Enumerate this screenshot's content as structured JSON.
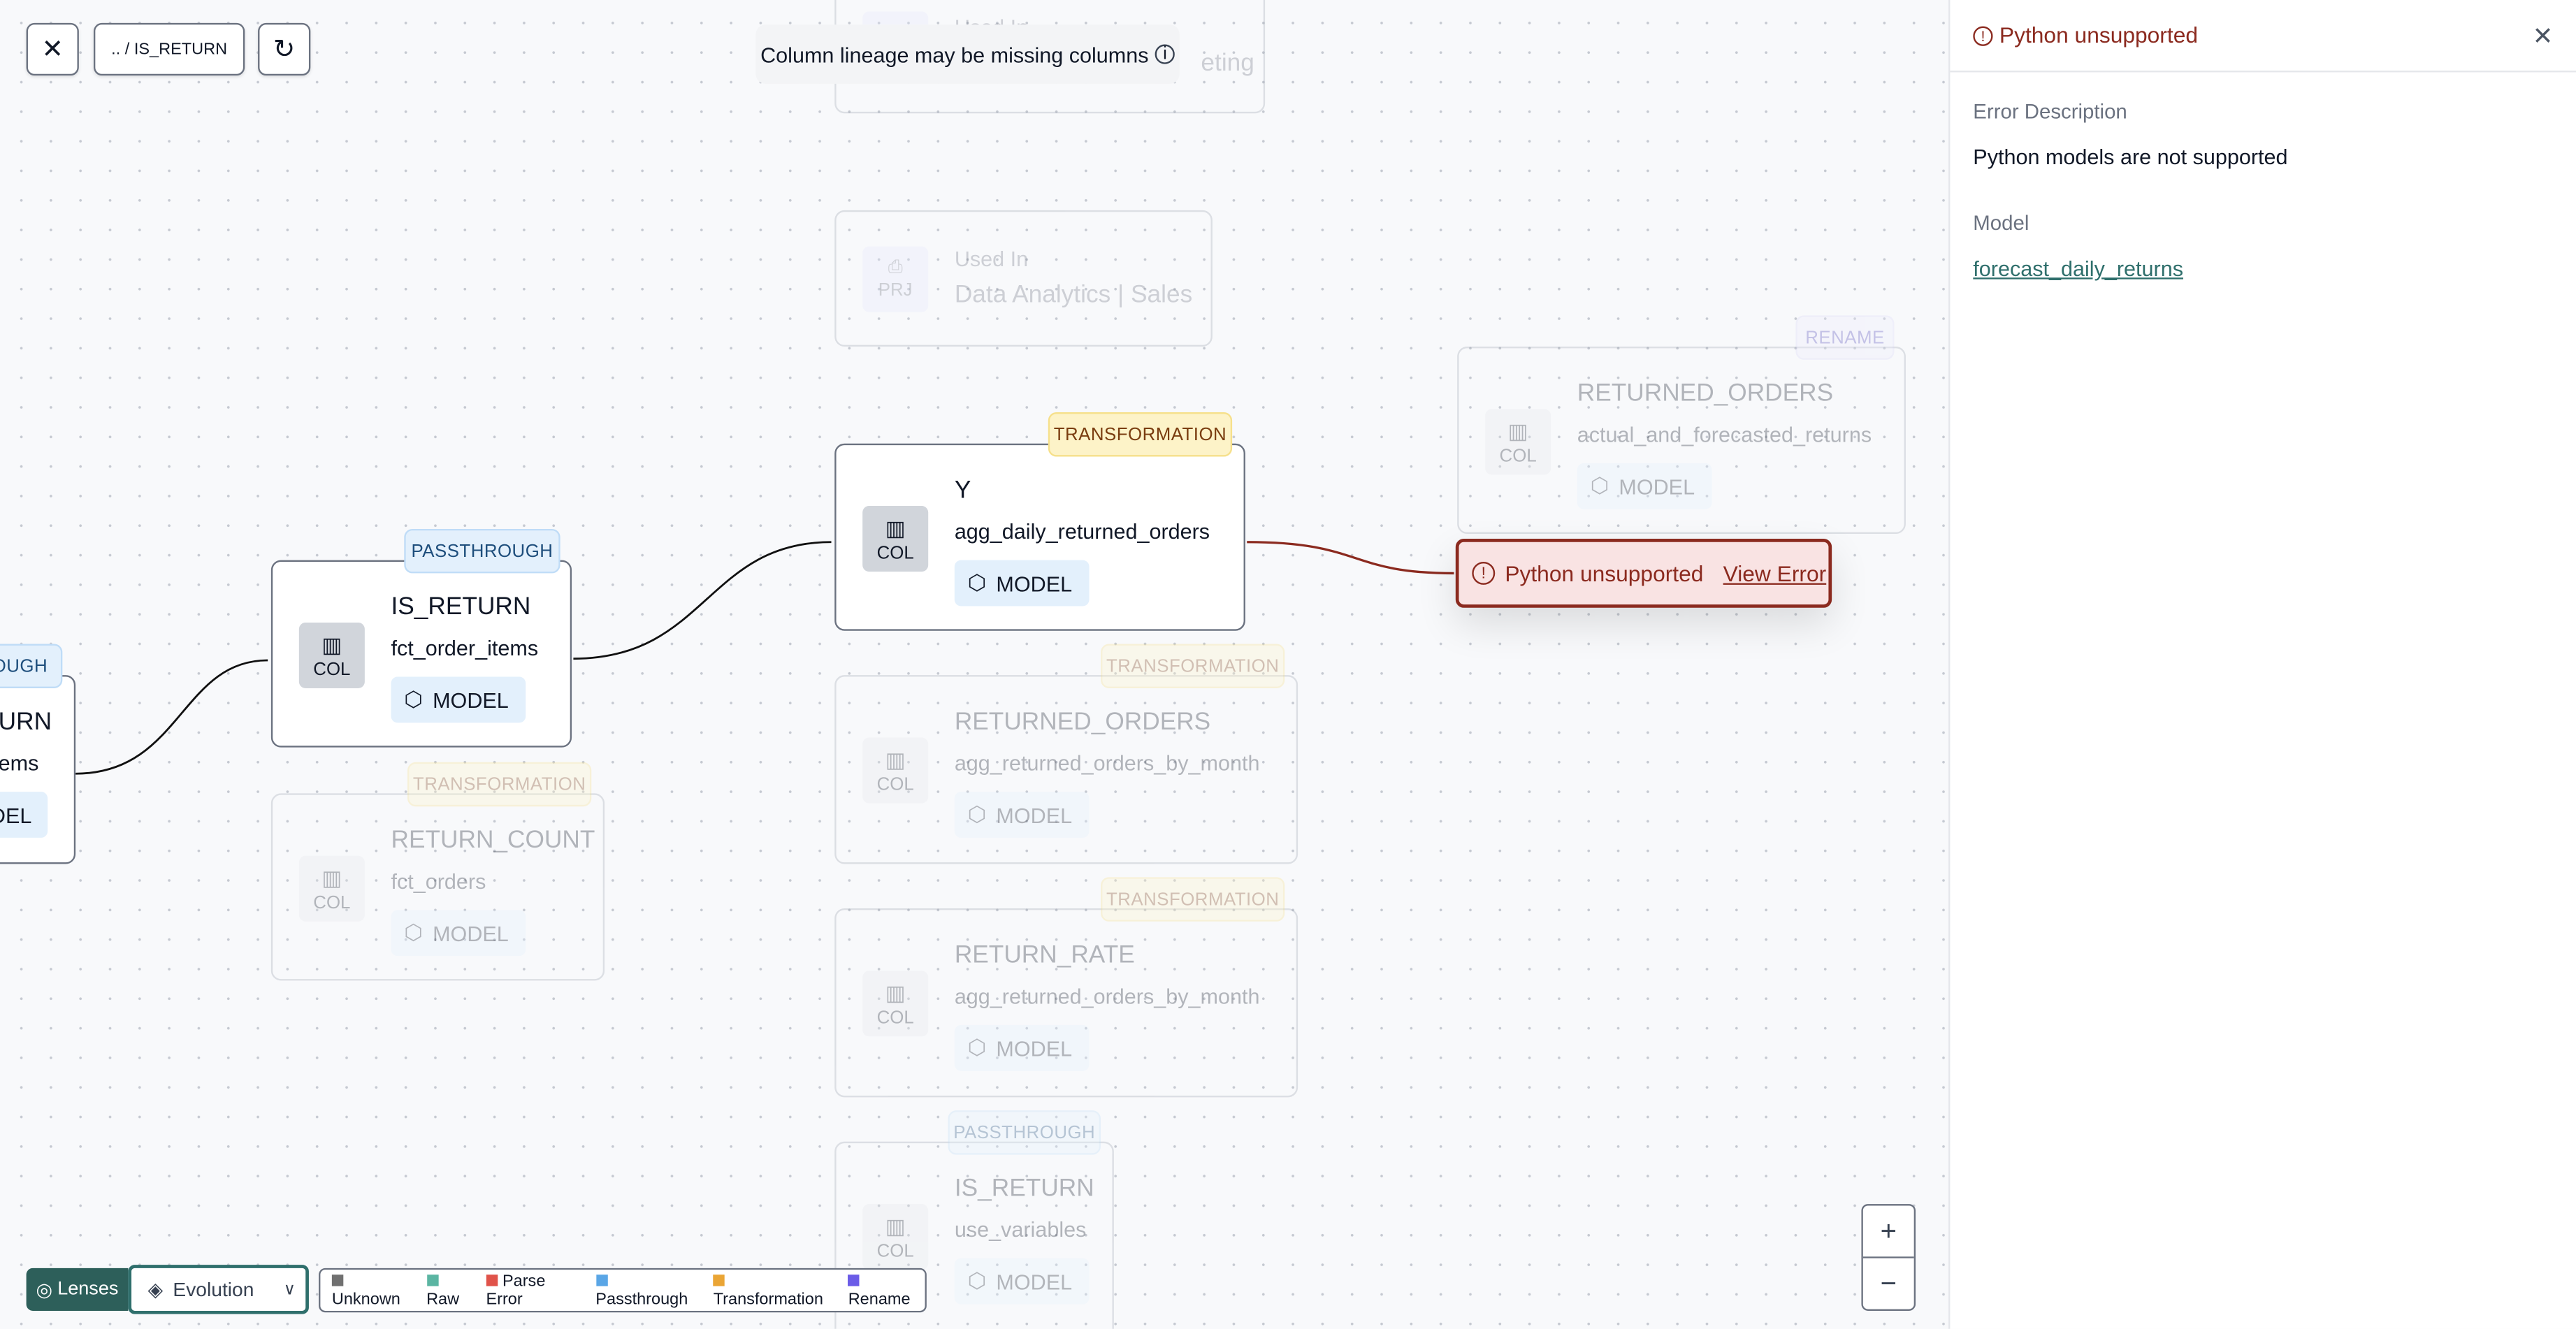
{
  "toolbar": {
    "close_icon": "close-icon",
    "breadcrumb": ".. / IS_RETURN",
    "refresh_icon": "refresh-icon"
  },
  "notice": {
    "text": "Column lineage may be missing columns",
    "icon": "info-icon"
  },
  "nodes": {
    "top_partial": {
      "label": "Used In",
      "value": "eting"
    },
    "used_in": {
      "icon_label": "PRJ",
      "label": "Used In",
      "value": "Data Analytics | Sales"
    },
    "left_partial": {
      "badge": "OUGH",
      "title": "URN",
      "subtitle": "ems",
      "chip": "DEL"
    },
    "is_return": {
      "badge": "PASSTHROUGH",
      "icon_label": "COL",
      "title": "IS_RETURN",
      "subtitle": "fct_order_items",
      "chip": "MODEL"
    },
    "return_count": {
      "badge": "TRANSFORMATION",
      "icon_label": "COL",
      "title": "RETURN_COUNT",
      "subtitle": "fct_orders",
      "chip": "MODEL"
    },
    "y": {
      "badge": "TRANSFORMATION",
      "icon_label": "COL",
      "title": "Y",
      "subtitle": "agg_daily_returned_orders",
      "chip": "MODEL"
    },
    "returned_orders_month": {
      "badge": "TRANSFORMATION",
      "icon_label": "COL",
      "title": "RETURNED_ORDERS",
      "subtitle": "agg_returned_orders_by_month",
      "chip": "MODEL"
    },
    "return_rate": {
      "badge": "TRANSFORMATION",
      "icon_label": "COL",
      "title": "RETURN_RATE",
      "subtitle": "agg_returned_orders_by_month",
      "chip": "MODEL"
    },
    "is_return_vars": {
      "badge": "PASSTHROUGH",
      "icon_label": "COL",
      "title": "IS_RETURN",
      "subtitle": "use_variables",
      "chip": "MODEL"
    },
    "returned_orders_rename": {
      "badge": "RENAME",
      "icon_label": "COL",
      "title": "RETURNED_ORDERS",
      "subtitle": "actual_and_forecasted_returns",
      "chip": "MODEL"
    }
  },
  "error_node": {
    "text": "Python unsupported",
    "link": "View Error"
  },
  "panel": {
    "title": "Python unsupported",
    "desc_label": "Error Description",
    "desc_value": "Python models are not supported",
    "model_label": "Model",
    "model_value": "forecast_daily_returns"
  },
  "zoom": {
    "in": "+",
    "out": "−"
  },
  "bottom": {
    "lenses": "Lenses",
    "mode": "Evolution",
    "legend": [
      {
        "label": "Unknown",
        "color": "#707070"
      },
      {
        "label": "Raw",
        "color": "#5bb5a2"
      },
      {
        "label": "Parse Error",
        "color": "#e0534a"
      },
      {
        "label": "Passthrough",
        "color": "#5aa6e6"
      },
      {
        "label": "Transformation",
        "color": "#eaa535"
      },
      {
        "label": "Rename",
        "color": "#6b5ce7"
      }
    ]
  },
  "colors": {
    "accent": "#2f6f6c",
    "error": "#8b2a1f"
  }
}
